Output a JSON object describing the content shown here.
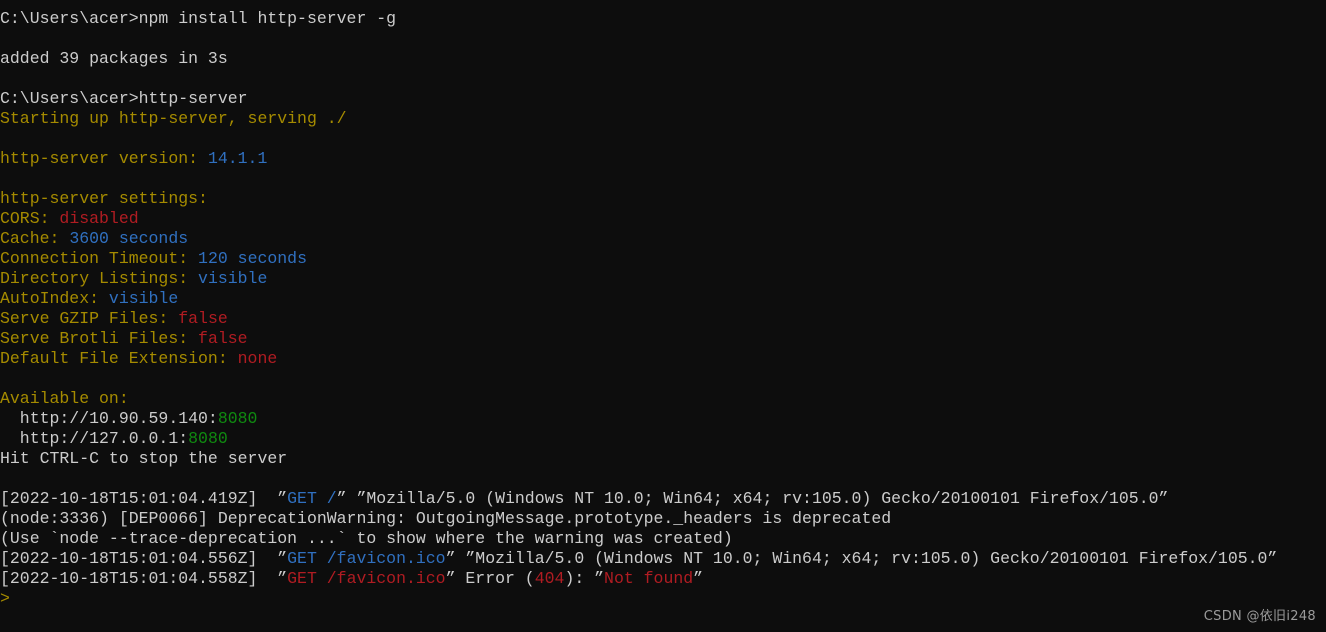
{
  "terminal": {
    "title": "Command Prompt",
    "background_color": "#0d0d0d",
    "colors": {
      "default_text": "#cccccc",
      "olive": "#a58b00",
      "blue": "#3070c0",
      "red": "#b01c22",
      "green": "#0f8a10"
    },
    "prompt_symbol": ">",
    "lines": [
      {
        "id": "cmd-npm-install",
        "segments": [
          {
            "text": "C:\\Users\\acer>npm install http-server -g",
            "color": "white"
          }
        ]
      },
      {
        "id": "blank-1",
        "segments": []
      },
      {
        "id": "npm-result",
        "segments": [
          {
            "text": "added 39 packages in 3s",
            "color": "white"
          }
        ]
      },
      {
        "id": "blank-2",
        "segments": []
      },
      {
        "id": "cmd-http-server",
        "segments": [
          {
            "text": "C:\\Users\\acer>http-server",
            "color": "white"
          }
        ]
      },
      {
        "id": "starting-up",
        "segments": [
          {
            "text": "Starting up http-server, serving ./",
            "color": "olive"
          }
        ]
      },
      {
        "id": "blank-3",
        "segments": []
      },
      {
        "id": "version-line",
        "segments": [
          {
            "text": "http-server version: ",
            "color": "olive"
          },
          {
            "text": "14.1.1",
            "color": "blue"
          }
        ]
      },
      {
        "id": "blank-4",
        "segments": []
      },
      {
        "id": "settings-header",
        "segments": [
          {
            "text": "http-server settings:",
            "color": "olive"
          }
        ]
      },
      {
        "id": "setting-cors",
        "segments": [
          {
            "text": "CORS: ",
            "color": "olive"
          },
          {
            "text": "disabled",
            "color": "red"
          }
        ]
      },
      {
        "id": "setting-cache",
        "segments": [
          {
            "text": "Cache: ",
            "color": "olive"
          },
          {
            "text": "3600",
            "color": "blue"
          },
          {
            "text": " seconds",
            "color": "blue"
          }
        ]
      },
      {
        "id": "setting-connection-timeout",
        "segments": [
          {
            "text": "Connection Timeout: ",
            "color": "olive"
          },
          {
            "text": "120",
            "color": "blue"
          },
          {
            "text": " seconds",
            "color": "blue"
          }
        ]
      },
      {
        "id": "setting-directory-listings",
        "segments": [
          {
            "text": "Directory Listings: ",
            "color": "olive"
          },
          {
            "text": "visible",
            "color": "blue"
          }
        ]
      },
      {
        "id": "setting-autoindex",
        "segments": [
          {
            "text": "AutoIndex: ",
            "color": "olive"
          },
          {
            "text": "visible",
            "color": "blue"
          }
        ]
      },
      {
        "id": "setting-gzip",
        "segments": [
          {
            "text": "Serve GZIP Files: ",
            "color": "olive"
          },
          {
            "text": "false",
            "color": "red"
          }
        ]
      },
      {
        "id": "setting-brotli",
        "segments": [
          {
            "text": "Serve Brotli Files: ",
            "color": "olive"
          },
          {
            "text": "false",
            "color": "red"
          }
        ]
      },
      {
        "id": "setting-default-ext",
        "segments": [
          {
            "text": "Default File Extension: ",
            "color": "olive"
          },
          {
            "text": "none",
            "color": "red"
          }
        ]
      },
      {
        "id": "blank-5",
        "segments": []
      },
      {
        "id": "available-on-header",
        "segments": [
          {
            "text": "Available on:",
            "color": "olive"
          }
        ]
      },
      {
        "id": "available-url-lan",
        "segments": [
          {
            "text": "  http://10.90.59.140:",
            "color": "white"
          },
          {
            "text": "8080",
            "color": "green"
          }
        ]
      },
      {
        "id": "available-url-local",
        "segments": [
          {
            "text": "  http://127.0.0.1:",
            "color": "white"
          },
          {
            "text": "8080",
            "color": "green"
          }
        ]
      },
      {
        "id": "hit-ctrl-c",
        "segments": [
          {
            "text": "Hit CTRL-C to stop the server",
            "color": "white"
          }
        ]
      },
      {
        "id": "blank-6",
        "segments": []
      },
      {
        "id": "log-get-root",
        "segments": [
          {
            "text": "[2022-10-18T15:01:04.419Z]  ”",
            "color": "white"
          },
          {
            "text": "GET /",
            "color": "blue"
          },
          {
            "text": "” ”Mozilla/5.0 (Windows NT 10.0; Win64; x64; rv:105.0) Gecko/20100101 Firefox/105.0”",
            "color": "white"
          }
        ]
      },
      {
        "id": "log-deprecation-warning",
        "segments": [
          {
            "text": "(node:3336) [DEP0066] DeprecationWarning: OutgoingMessage.prototype._headers is deprecated",
            "color": "white"
          }
        ]
      },
      {
        "id": "log-trace-deprecation-hint",
        "segments": [
          {
            "text": "(Use `node --trace-deprecation ...` to show where the warning was created)",
            "color": "white"
          }
        ]
      },
      {
        "id": "log-get-favicon",
        "segments": [
          {
            "text": "[2022-10-18T15:01:04.556Z]  ”",
            "color": "white"
          },
          {
            "text": "GET /favicon.ico",
            "color": "blue"
          },
          {
            "text": "” ”Mozilla/5.0 (Windows NT 10.0; Win64; x64; rv:105.0) Gecko/20100101 Firefox/105.0”",
            "color": "white"
          }
        ]
      },
      {
        "id": "log-get-favicon-404",
        "segments": [
          {
            "text": "[2022-10-18T15:01:04.558Z]  ”",
            "color": "white"
          },
          {
            "text": "GET /favicon.ico",
            "color": "red"
          },
          {
            "text": "” Error (",
            "color": "white"
          },
          {
            "text": "404",
            "color": "red"
          },
          {
            "text": "): ”",
            "color": "white"
          },
          {
            "text": "Not found",
            "color": "red"
          },
          {
            "text": "”",
            "color": "white"
          }
        ]
      },
      {
        "id": "prompt-cursor-line",
        "segments": [
          {
            "text": ">",
            "color": "olive"
          }
        ]
      }
    ]
  },
  "watermark": {
    "text": "CSDN @依旧i248"
  }
}
